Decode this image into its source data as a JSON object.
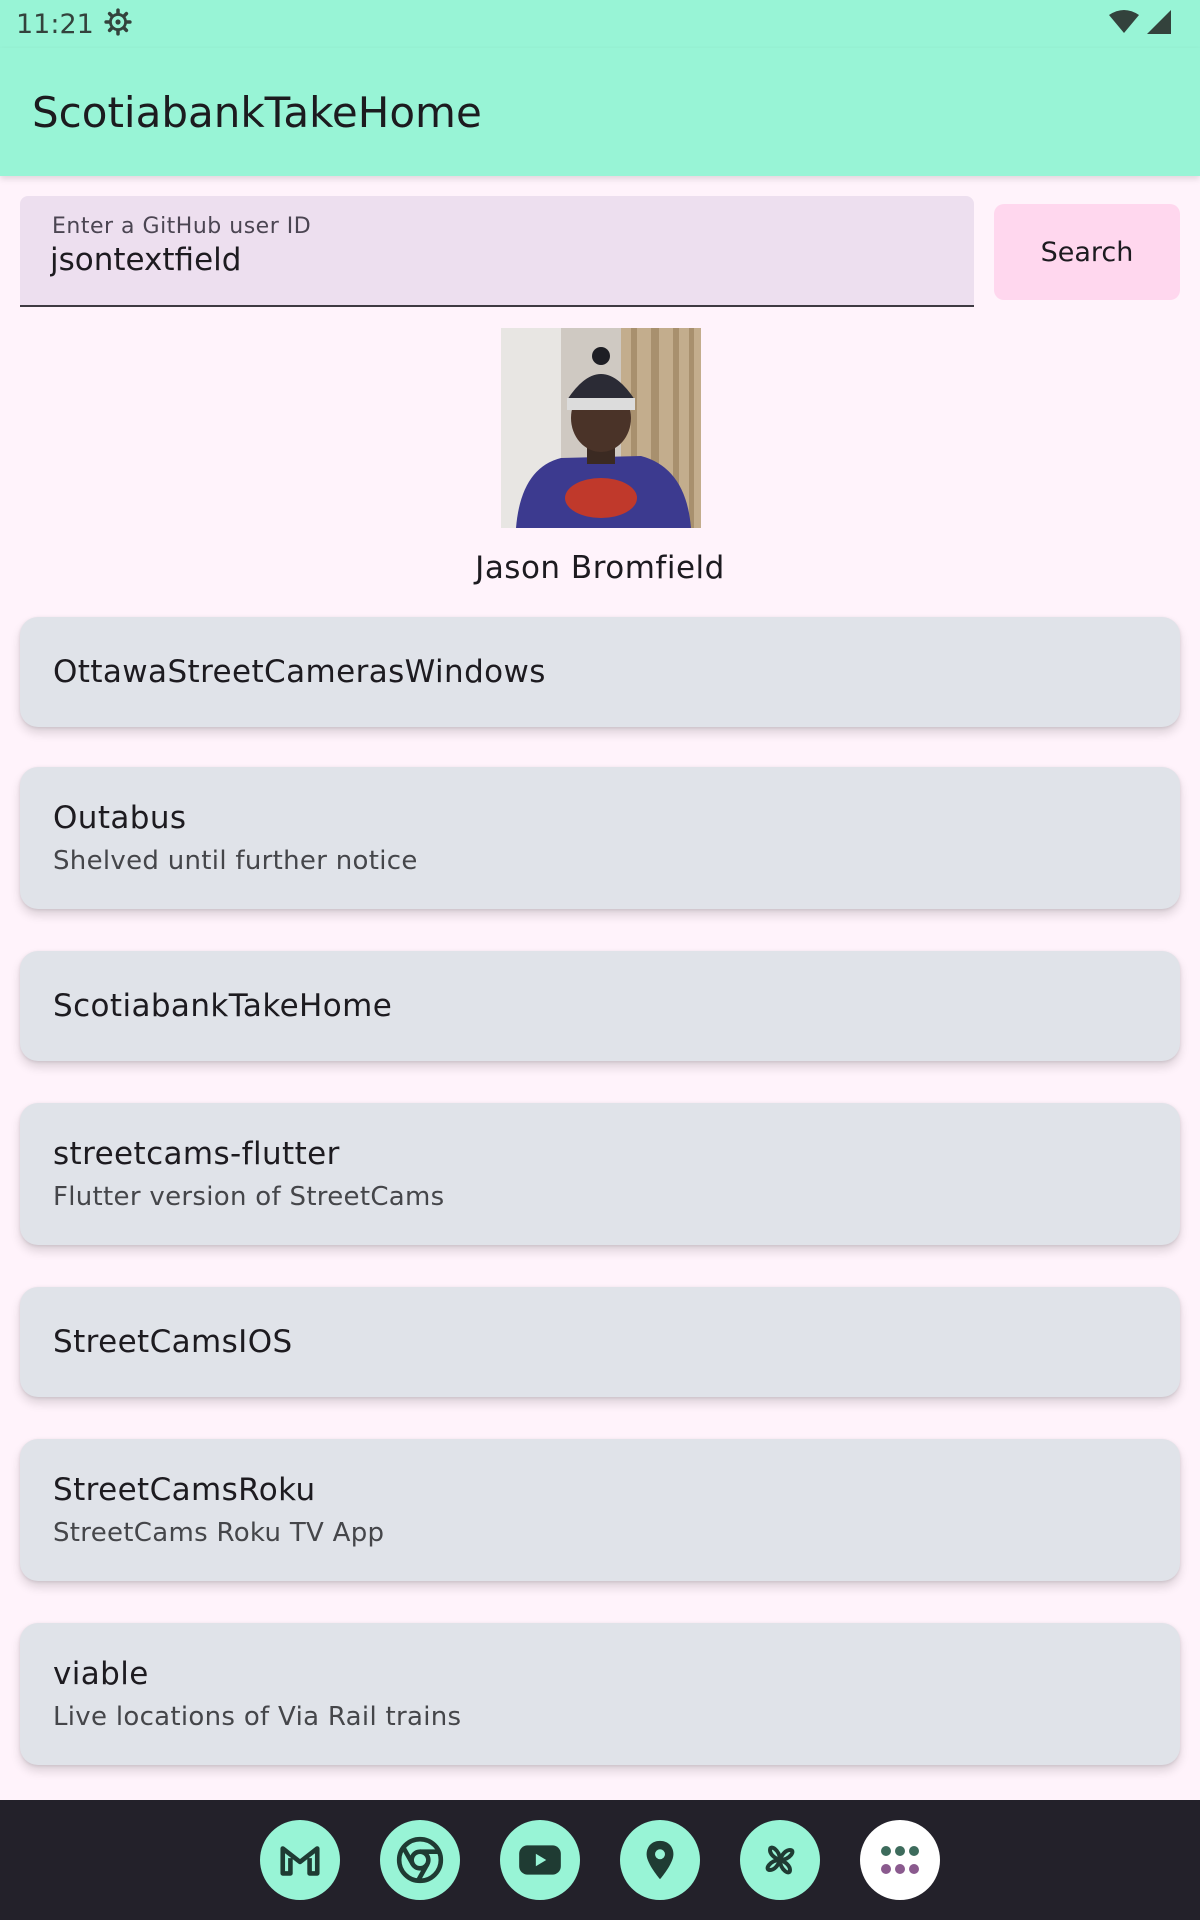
{
  "status_bar": {
    "time": "11:21"
  },
  "app_bar": {
    "title": "ScotiabankTakeHome"
  },
  "search": {
    "label": "Enter a GitHub user ID",
    "value": "jsontextfield",
    "button_label": "Search"
  },
  "user": {
    "name": "Jason Bromfield"
  },
  "repos": [
    {
      "name": "OttawaStreetCamerasWindows",
      "description": ""
    },
    {
      "name": "Outabus",
      "description": "Shelved until further notice"
    },
    {
      "name": "ScotiabankTakeHome",
      "description": ""
    },
    {
      "name": "streetcams-flutter",
      "description": "Flutter version of StreetCams"
    },
    {
      "name": "StreetCamsIOS",
      "description": ""
    },
    {
      "name": "StreetCamsRoku",
      "description": "StreetCams Roku TV App"
    },
    {
      "name": "viable",
      "description": "Live locations of Via Rail trains"
    }
  ],
  "dock": {
    "apps": [
      "gmail-icon",
      "chrome-icon",
      "youtube-icon",
      "maps-icon",
      "photos-icon",
      "app-drawer-icon"
    ]
  },
  "colors": {
    "app_bar": "#98f4d6",
    "background": "#fff3fb",
    "card": "#e0e3e9",
    "search_button": "#ffd7ee",
    "text_field": "#eddfef",
    "nav_bar": "#23212a"
  }
}
